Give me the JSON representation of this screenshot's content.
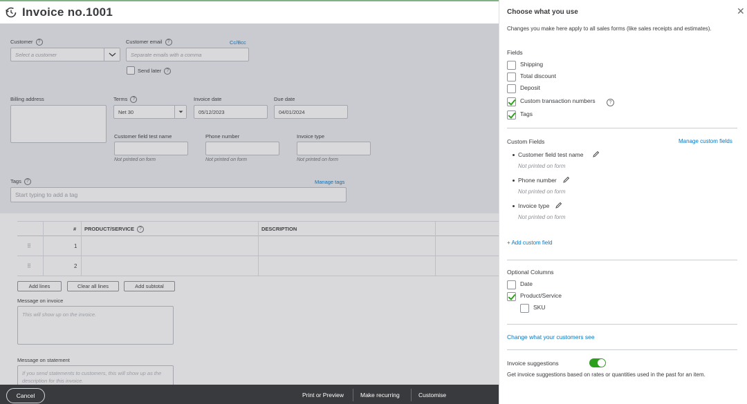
{
  "header": {
    "title": "Invoice no.1001",
    "icon": "history-icon"
  },
  "form": {
    "customer": {
      "label": "Customer",
      "placeholder": "Select a customer"
    },
    "customer_email": {
      "label": "Customer email",
      "placeholder": "Separate emails with a comma",
      "cc_bcc": "Cc/Bcc"
    },
    "send_later": "Send later",
    "billing_address": {
      "label": "Billing address"
    },
    "terms": {
      "label": "Terms",
      "value": "Net 30"
    },
    "invoice_date": {
      "label": "Invoice date",
      "value": "05/12/2023"
    },
    "due_date": {
      "label": "Due date",
      "value": "04/01/2024"
    },
    "custom_fields": [
      {
        "label": "Customer field test name",
        "note": "Not printed on form"
      },
      {
        "label": "Phone number",
        "note": "Not printed on form"
      },
      {
        "label": "Invoice type",
        "note": "Not printed on form"
      }
    ],
    "tags": {
      "label": "Tags",
      "placeholder": "Start typing to add a tag",
      "manage": "Manage tags"
    }
  },
  "table": {
    "headers": [
      "#",
      "PRODUCT/SERVICE",
      "DESCRIPTION"
    ],
    "rows": [
      "1",
      "2"
    ]
  },
  "line_buttons": [
    "Add lines",
    "Clear all lines",
    "Add subtotal"
  ],
  "message_invoice": {
    "label": "Message on invoice",
    "placeholder": "This will show up on the invoice."
  },
  "message_statement": {
    "label": "Message on statement",
    "placeholder": "If you send statements to customers, this will show up as the description for this invoice."
  },
  "footer": {
    "cancel": "Cancel",
    "print": "Print or Preview",
    "recurring": "Make recurring",
    "customise": "Customise"
  },
  "panel": {
    "title": "Choose what you use",
    "description": "Changes you make here apply to all sales forms (like sales receipts and estimates).",
    "fields_heading": "Fields",
    "fields": [
      {
        "label": "Shipping",
        "checked": false
      },
      {
        "label": "Total discount",
        "checked": false
      },
      {
        "label": "Deposit",
        "checked": false
      },
      {
        "label": "Custom transaction numbers",
        "checked": true
      },
      {
        "label": "Tags",
        "checked": true
      }
    ],
    "custom_fields_heading": "Custom Fields",
    "manage_custom_fields": "Manage custom fields",
    "custom_fields": [
      {
        "label": "Customer field test name",
        "note": "Not printed on form"
      },
      {
        "label": "Phone number",
        "note": "Not printed on form"
      },
      {
        "label": "Invoice type",
        "note": "Not printed on form"
      }
    ],
    "add_custom_field": "+ Add custom field",
    "optional_columns_heading": "Optional Columns",
    "optional_columns": [
      {
        "label": "Date",
        "checked": false
      },
      {
        "label": "Product/Service",
        "checked": true
      },
      {
        "label": "SKU",
        "checked": false
      }
    ],
    "change_link": "Change what your customers see",
    "invoice_suggestions": {
      "label": "Invoice suggestions",
      "enabled": true,
      "description": "Get invoice suggestions based on rates or quantities used in the past for an item."
    },
    "accent_color": "#2ca01c",
    "link_color": "#0077c5"
  }
}
